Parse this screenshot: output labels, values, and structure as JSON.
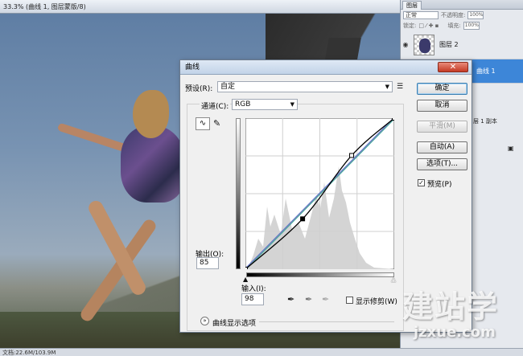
{
  "document": {
    "title": "33.3% (曲线 1, 图层蒙版/8)",
    "status": "文档:22.6M/103.9M"
  },
  "layers_panel": {
    "tab": "图层",
    "blend_mode": "正常",
    "opacity_label": "不透明度:",
    "opacity_value": "100%",
    "lock_label": "锁定:",
    "fill_label": "填充:",
    "fill_value": "100%",
    "layers": [
      {
        "name": "图层 2"
      },
      {
        "name": "曲线 1"
      }
    ],
    "partial_label": "层 1 副本"
  },
  "curves_dialog": {
    "title": "曲线",
    "close_glyph": "✕",
    "preset_label": "预设(R):",
    "preset_value": "自定",
    "channel_label": "通道(C):",
    "channel_value": "RGB",
    "output_label": "输出(O):",
    "output_value": "85",
    "input_label": "输入(I):",
    "input_value": "98",
    "show_clipping_label": "显示修剪(W)",
    "curve_display_label": "曲线显示选项",
    "buttons": {
      "ok": "确定",
      "cancel": "取消",
      "smooth": "平滑(M)",
      "auto": "自动(A)",
      "options": "选项(T)..."
    },
    "preview_label": "预览(P)",
    "preview_checked": true,
    "curve_points": [
      {
        "input": 0,
        "output": 0
      },
      {
        "input": 98,
        "output": 85
      },
      {
        "input": 182,
        "output": 192
      },
      {
        "input": 255,
        "output": 255
      }
    ]
  },
  "watermark": {
    "big": "建站学",
    "small": "jzxue.com"
  }
}
